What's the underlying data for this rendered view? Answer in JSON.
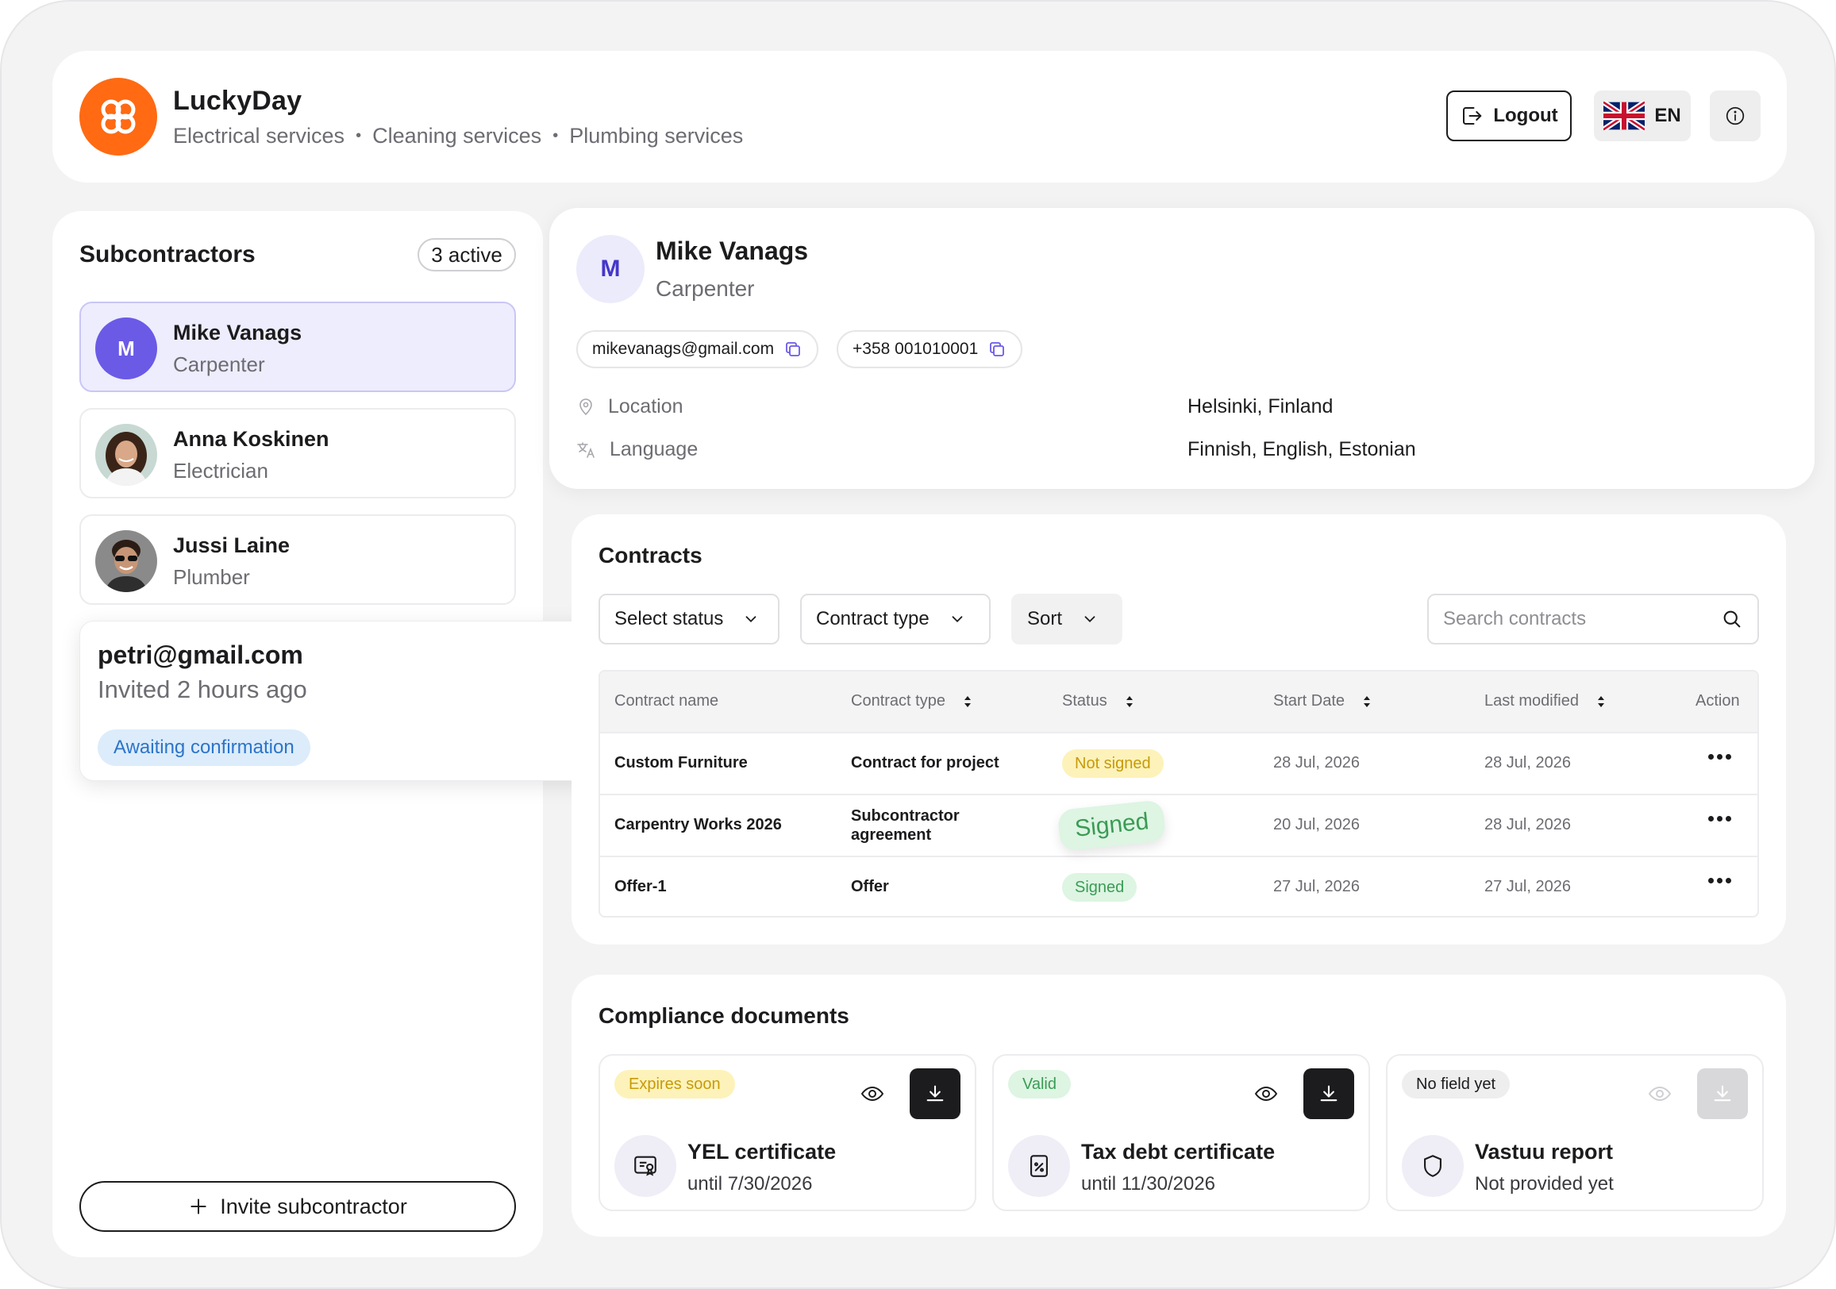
{
  "header": {
    "brand": "LuckyDay",
    "services": [
      "Electrical services",
      "Cleaning services",
      "Plumbing services"
    ],
    "logout_label": "Logout",
    "language_label": "EN"
  },
  "sidebar": {
    "title": "Subcontractors",
    "active_count": "3 active",
    "items": [
      {
        "initial": "M",
        "name": "Mike Vanags",
        "role": "Carpenter"
      },
      {
        "name": "Anna Koskinen",
        "role": "Electrician"
      },
      {
        "name": "Jussi Laine",
        "role": "Plumber"
      }
    ],
    "invite": {
      "email": "petri@gmail.com",
      "time": "Invited 2 hours ago",
      "status": "Awaiting confirmation"
    },
    "invite_button": "Invite subcontractor"
  },
  "profile": {
    "initial": "M",
    "name": "Mike Vanags",
    "role": "Carpenter",
    "email": "mikevanags@gmail.com",
    "phone": "+358 001010001",
    "location_label": "Location",
    "location_value": "Helsinki, Finland",
    "language_label": "Language",
    "language_value": "Finnish, English, Estonian"
  },
  "contracts": {
    "title": "Contracts",
    "filters": {
      "status": "Select status",
      "type": "Contract type",
      "sort": "Sort"
    },
    "search_placeholder": "Search contracts",
    "columns": [
      "Contract name",
      "Contract type",
      "Status",
      "Start Date",
      "Last modified",
      "Action"
    ],
    "rows": [
      {
        "name": "Custom Furniture",
        "type": "Contract for project",
        "status": "Not signed",
        "start": "28 Jul, 2026",
        "modified": "28 Jul, 2026"
      },
      {
        "name": "Carpentry Works 2026",
        "type_line1": "Subcontractor",
        "type_line2": "agreement",
        "status": "Signed",
        "start": "20 Jul, 2026",
        "modified": "28 Jul, 2026"
      },
      {
        "name": "Offer-1",
        "type": "Offer",
        "status": "Signed",
        "start": "27 Jul, 2026",
        "modified": "27 Jul, 2026"
      }
    ]
  },
  "compliance": {
    "title": "Compliance documents",
    "docs": [
      {
        "tag": "Expires soon",
        "name": "YEL certificate",
        "sub": "until 7/30/2026"
      },
      {
        "tag": "Valid",
        "name": "Tax debt certificate",
        "sub": "until 11/30/2026"
      },
      {
        "tag": "No field yet",
        "name": "Vastuu report",
        "sub": "Not provided yet"
      }
    ]
  },
  "colors": {
    "brand": "#ff6a13",
    "accent": "#6a5ae6"
  }
}
